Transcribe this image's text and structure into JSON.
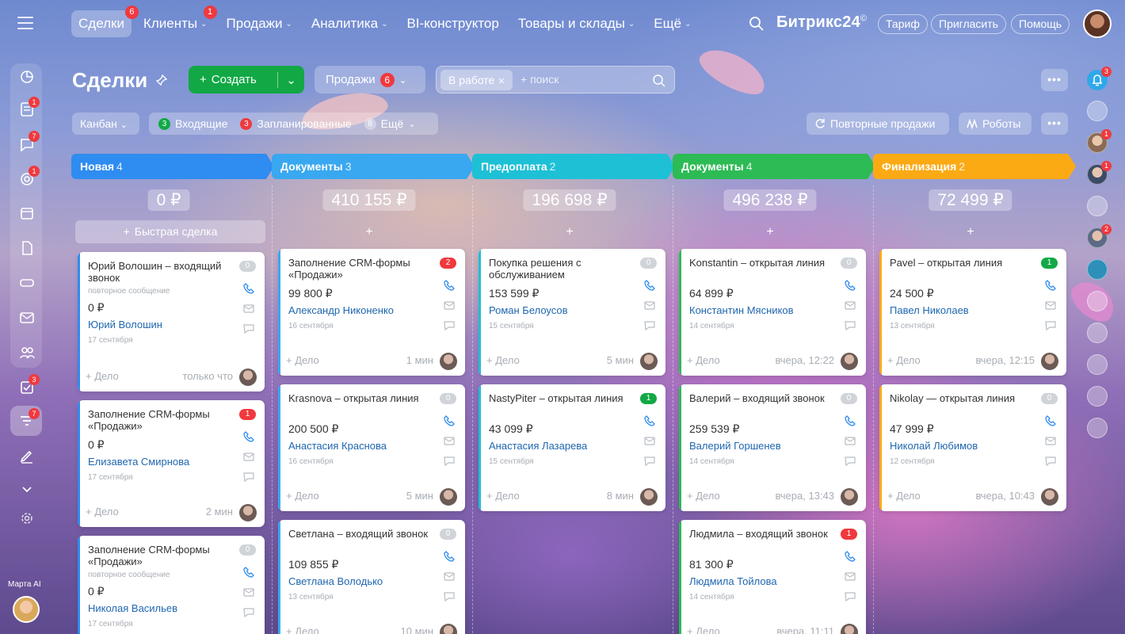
{
  "nav": {
    "items": [
      {
        "label": "Сделки",
        "badge": "6",
        "active": true,
        "dropdown": false
      },
      {
        "label": "Клиенты",
        "badge": "1",
        "active": false,
        "dropdown": true
      },
      {
        "label": "Продажи",
        "badge": "",
        "active": false,
        "dropdown": true
      },
      {
        "label": "Аналитика",
        "badge": "",
        "active": false,
        "dropdown": true
      },
      {
        "label": "BI-конструктор",
        "badge": "",
        "active": false,
        "dropdown": false
      },
      {
        "label": "Товары и склады",
        "badge": "",
        "active": false,
        "dropdown": true
      },
      {
        "label": "Ещё",
        "badge": "",
        "active": false,
        "dropdown": true
      }
    ],
    "brand": "Битрикс24",
    "brand_mark": "©",
    "tariff": "Тариф",
    "invite": "Пригласить",
    "help": "Помощь"
  },
  "sidebar_left": {
    "badges": {
      "tasks": "1",
      "chat": "7",
      "feed": "1",
      "todo": "3",
      "crm": "7"
    },
    "ai_label": "Марта AI"
  },
  "header": {
    "title": "Сделки",
    "create": "Создать",
    "funnel": "Продажи",
    "funnel_count": "6",
    "filter_tag": "В работе",
    "search_placeholder": "+ поиск",
    "more": "•••"
  },
  "toolbar": {
    "view": "Канбан",
    "incoming_count": "3",
    "incoming": "Входящие",
    "planned_count": "3",
    "planned": "Запланированные",
    "more_count": "8",
    "more": "Ещё",
    "repeat_sales": "Повторные продажи",
    "robots": "Роботы"
  },
  "board": {
    "quick_deal": "Быстрая сделка",
    "add_deal": "+ Дело",
    "add_sign": "+",
    "columns": [
      {
        "name": "Новая",
        "count": "4",
        "color": "#2f8cf0",
        "sum": "0 ₽",
        "cards": [
          {
            "title": "Юрий Волошин – входящий звонок",
            "badge": "0",
            "badge_type": "zero",
            "sub": "повторное сообщение",
            "sum": "0 ₽",
            "client": "Юрий Волошин",
            "date": "17 сентября",
            "time": "только что"
          },
          {
            "title": "Заполнение CRM-формы «Продажи»",
            "badge": "1",
            "badge_type": "red",
            "sub": "",
            "sum": "0 ₽",
            "client": "Елизавета Смирнова",
            "date": "17 сентября",
            "time": "2 мин"
          },
          {
            "title": "Заполнение CRM-формы «Продажи»",
            "badge": "0",
            "badge_type": "zero",
            "sub": "повторное сообщение",
            "sum": "0 ₽",
            "client": "Николая Васильев",
            "date": "17 сентября",
            "time": ""
          }
        ]
      },
      {
        "name": "Документы",
        "count": "3",
        "color": "#39a8f0",
        "sum": "410 155 ₽",
        "cards": [
          {
            "title": "Заполнение CRM-формы «Продажи»",
            "badge": "2",
            "badge_type": "red",
            "sub": "",
            "sum": "99 800 ₽",
            "client": "Александр Никоненко",
            "date": "16 сентября",
            "time": "1 мин"
          },
          {
            "title": "Krasnova – открытая линия",
            "badge": "0",
            "badge_type": "zero",
            "sub": "",
            "sum": "200 500 ₽",
            "client": "Анастасия Краснова",
            "date": "16 сентября",
            "time": "5 мин"
          },
          {
            "title": "Светлана – входящий звонок",
            "badge": "0",
            "badge_type": "zero",
            "sub": "",
            "sum": "109 855 ₽",
            "client": "Светлана Володько",
            "date": "13 сентября",
            "time": "10 мин"
          }
        ]
      },
      {
        "name": "Предоплата",
        "count": "2",
        "color": "#1ec0d6",
        "sum": "196 698 ₽",
        "cards": [
          {
            "title": "Покупка решения с обслуживанием",
            "badge": "0",
            "badge_type": "zero",
            "sub": "",
            "sum": "153 599 ₽",
            "client": "Роман Белоусов",
            "date": "15 сентября",
            "time": "5 мин"
          },
          {
            "title": "NastyPiter – открытая линия",
            "badge": "1",
            "badge_type": "green",
            "sub": "",
            "sum": "43 099 ₽",
            "client": "Анастасия Лазарева",
            "date": "15 сентября",
            "time": "8 мин"
          }
        ]
      },
      {
        "name": "Документы",
        "count": "4",
        "color": "#2dbb55",
        "sum": "496 238 ₽",
        "cards": [
          {
            "title": "Konstantin – открытая линия",
            "badge": "0",
            "badge_type": "zero",
            "sub": "",
            "sum": "64 899 ₽",
            "client": "Константин Мясников",
            "date": "14 сентября",
            "time": "вчера, 12:22"
          },
          {
            "title": "Валерий – входящий звонок",
            "badge": "0",
            "badge_type": "zero",
            "sub": "",
            "sum": "259 539 ₽",
            "client": "Валерий Горшенев",
            "date": "14 сентября",
            "time": "вчера, 13:43"
          },
          {
            "title": "Людмила – входящий звонок",
            "badge": "1",
            "badge_type": "red",
            "sub": "",
            "sum": "81 300 ₽",
            "client": "Людмила Тойлова",
            "date": "14 сентября",
            "time": "вчера, 11:11"
          }
        ]
      },
      {
        "name": "Финализация",
        "count": "2",
        "color": "#fbaa14",
        "sum": "72 499 ₽",
        "cards": [
          {
            "title": "Pavel – открытая линия",
            "badge": "1",
            "badge_type": "green",
            "sub": "",
            "sum": "24 500 ₽",
            "client": "Павел Николаев",
            "date": "13 сентября",
            "time": "вчера, 12:15"
          },
          {
            "title": "Nikolay — открытая линия",
            "badge": "0",
            "badge_type": "zero",
            "sub": "",
            "sum": "47 999 ₽",
            "client": "Николай Любимов",
            "date": "12 сентября",
            "time": "вчера, 10:43"
          }
        ]
      }
    ]
  },
  "sidebar_right": {
    "notifications": "3",
    "badges": [
      "1",
      "1",
      "2"
    ]
  }
}
